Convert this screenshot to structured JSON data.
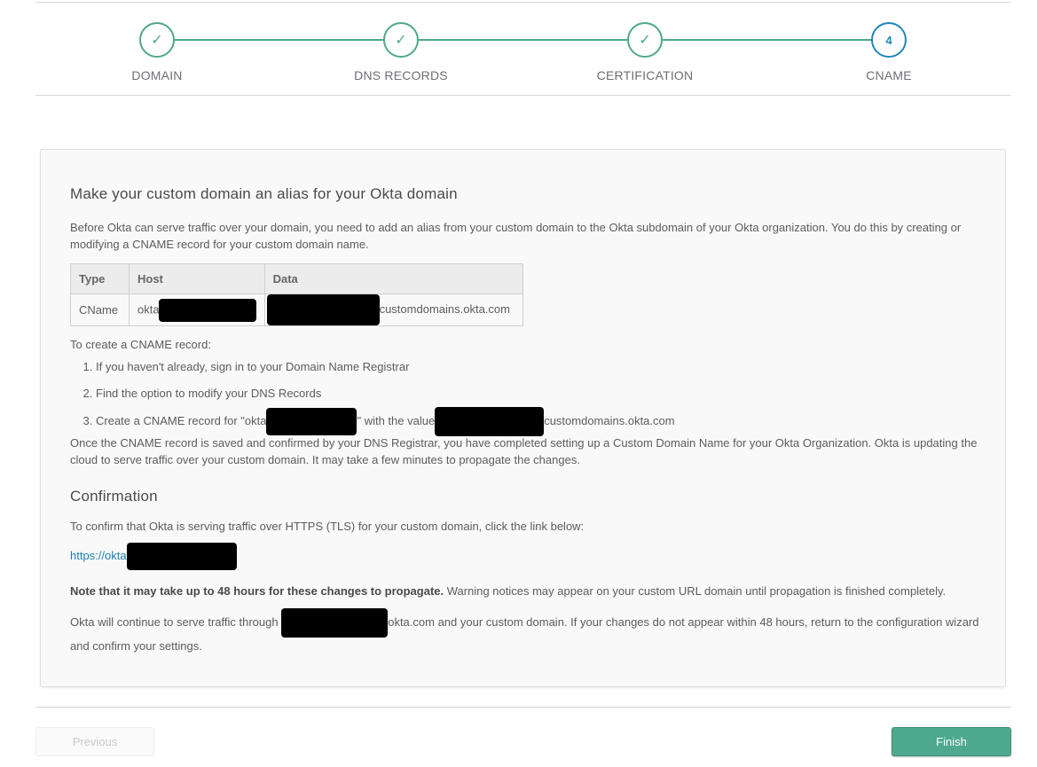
{
  "stepper": {
    "steps": [
      {
        "label": "DOMAIN",
        "status": "done",
        "marker": "✓"
      },
      {
        "label": "DNS RECORDS",
        "status": "done",
        "marker": "✓"
      },
      {
        "label": "CERTIFICATION",
        "status": "done",
        "marker": "✓"
      },
      {
        "label": "CNAME",
        "status": "current",
        "marker": "4"
      }
    ],
    "done_color": "#4ea88d",
    "current_color": "#1d87b8"
  },
  "main": {
    "title": "Make your custom domain an alias for your Okta domain",
    "intro": "Before Okta can serve traffic over your domain, you need to add an alias from your custom domain to the Okta subdomain of your Okta organization. You do this by creating or modifying a CNAME record for your custom domain name.",
    "table": {
      "headers": [
        "Type",
        "Host",
        "Data"
      ],
      "row": {
        "type": "CName",
        "host_prefix": "okta",
        "data_suffix": "customdomains.okta.com"
      }
    },
    "howto_intro": "To create a CNAME record:",
    "howto_steps": {
      "s1": "If you haven't already, sign in to your Domain Name Registrar",
      "s2": "Find the option to modify your DNS Records",
      "s3_a": "Create a CNAME record for \"okta",
      "s3_b": "\" with the value",
      "s3_c": "customdomains.okta.com"
    },
    "saved_note": "Once the CNAME record is saved and confirmed by your DNS Registrar, you have completed setting up a Custom Domain Name for your Okta Organization. Okta is updating the cloud to serve traffic over your custom domain. It may take a few minutes to propagate the changes.",
    "confirmation_title": "Confirmation",
    "confirm_intro": "To confirm that Okta is serving traffic over HTTPS (TLS) for your custom domain, click the link below:",
    "confirm_link_prefix": "https://okta",
    "note_bold": "Note that it may take up to 48 hours for these changes to propagate.",
    "note_rest": " Warning notices may appear on your custom URL domain until propagation is finished completely.",
    "continue_a": "Okta will continue to serve traffic through ",
    "continue_b": "okta.com and your custom domain. If your changes do not appear within 48 hours, return to the configuration wizard and confirm your settings."
  },
  "footer": {
    "previous_label": "Previous",
    "finish_label": "Finish"
  }
}
